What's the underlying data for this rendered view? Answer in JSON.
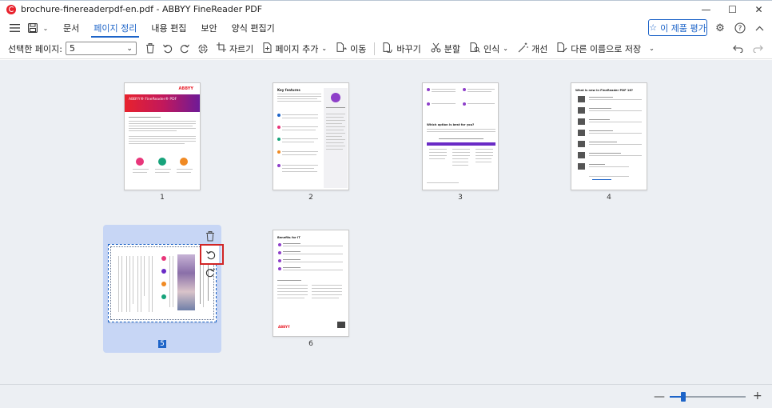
{
  "window": {
    "title": "brochure-finereaderpdf-en.pdf - ABBYY FineReader PDF",
    "controls": [
      "—",
      "☐",
      "✕"
    ]
  },
  "menu": {
    "items": [
      "문서",
      "페이지 정리",
      "내용 편집",
      "보안",
      "양식 편집기"
    ],
    "active_index": 1,
    "rate_button": "이 제품 평가"
  },
  "toolbar": {
    "selected_pages_label": "선택한 페이지:",
    "selected_pages_value": "5",
    "crop": "자르기",
    "add_page": "페이지 추가",
    "move": "이동",
    "replace": "바꾸기",
    "split": "분할",
    "recognize": "인식",
    "improve": "개선",
    "save_as": "다른 이름으로 저장"
  },
  "pages": [
    {
      "number": "1",
      "brand": "ABBYY",
      "heading": "ABBYY® FineReader® PDF"
    },
    {
      "number": "2",
      "heading": "Key features"
    },
    {
      "number": "3",
      "heading": "Which option is best for you?"
    },
    {
      "number": "4",
      "heading": "What is new in FineReader PDF 16?"
    },
    {
      "number": "5"
    },
    {
      "number": "6",
      "heading": "Benefits for IT",
      "brand": "ABBYY"
    }
  ],
  "selected_page": "5",
  "zoom": {
    "level_fraction": 0.18
  },
  "colors": {
    "accent": "#1d64c8",
    "selection_bg": "#c7d6f5",
    "highlight_box": "#d12525",
    "workspace": "#eceff3",
    "brand_red": "#e8222d",
    "brand_pink": "#e8367a"
  }
}
